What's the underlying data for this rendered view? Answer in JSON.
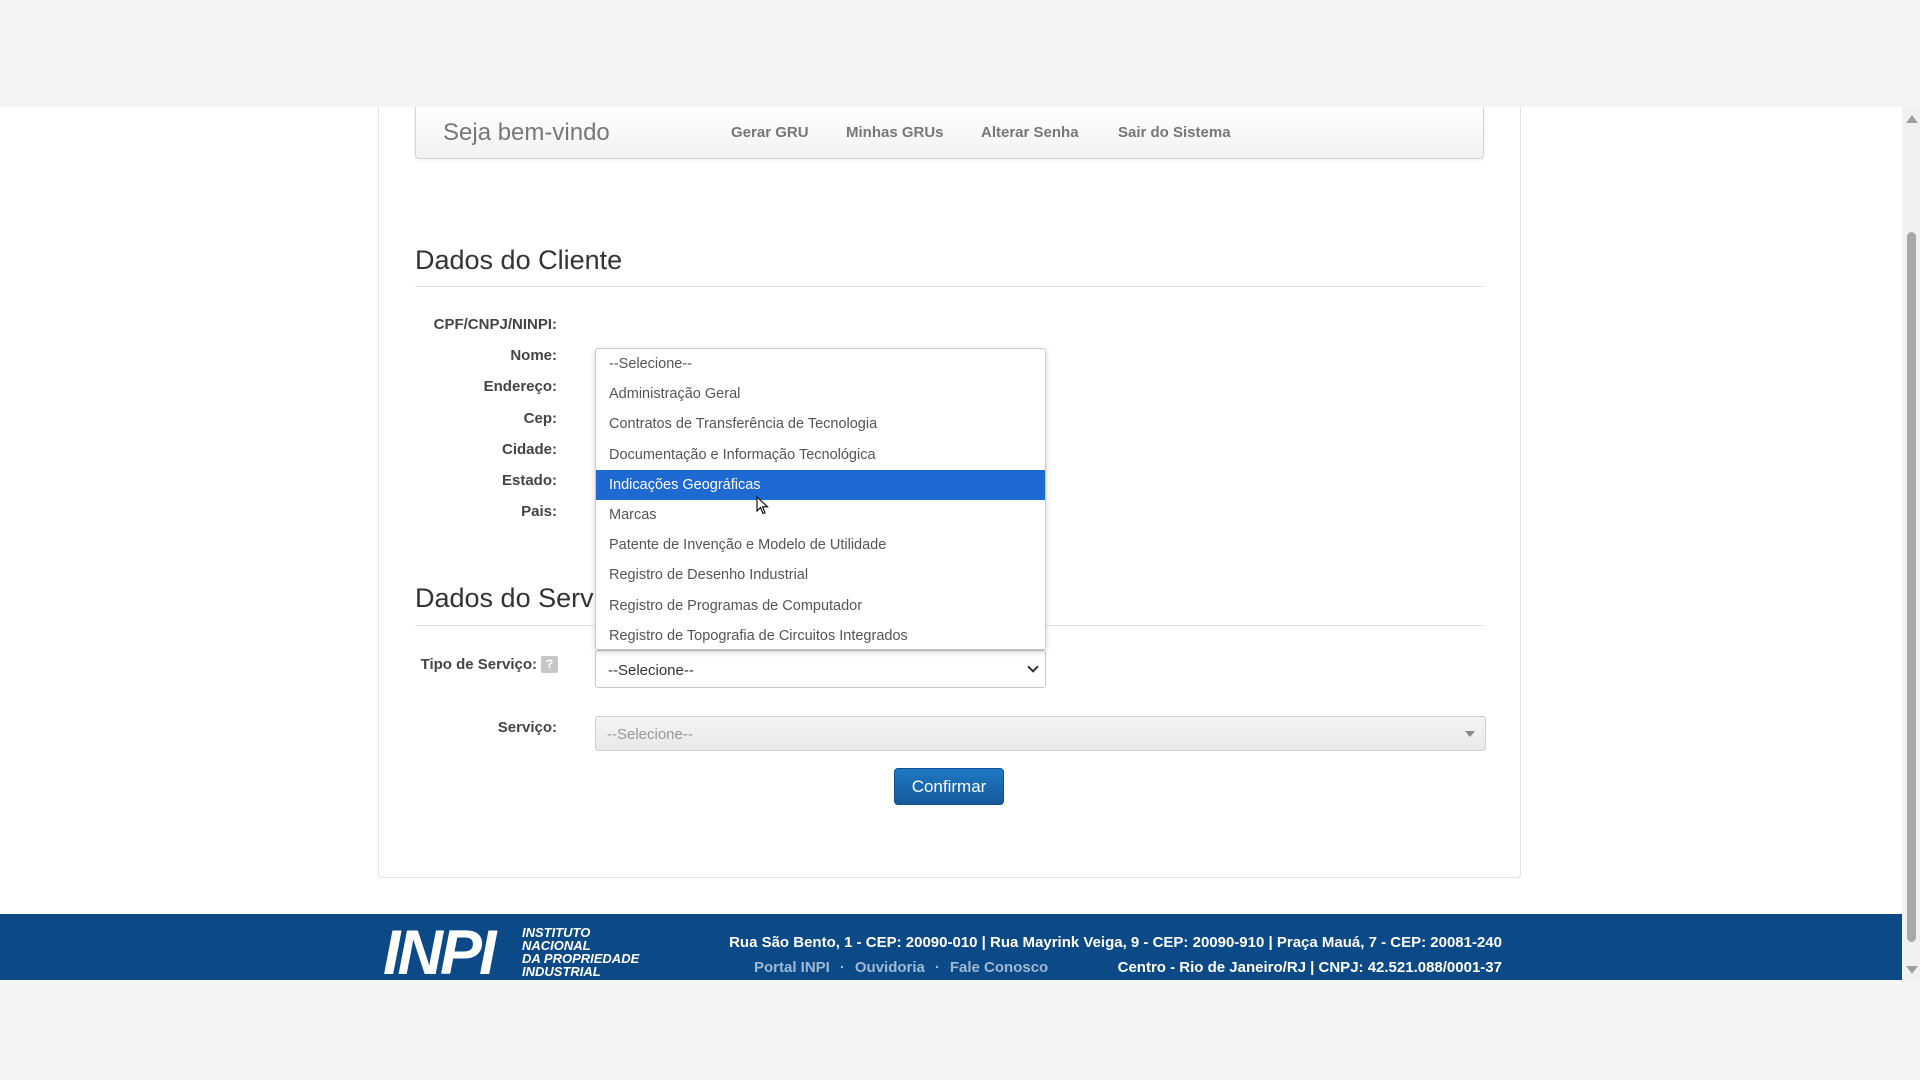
{
  "navbar": {
    "brand": "Seja bem-vindo",
    "links": [
      "Gerar GRU",
      "Minhas GRUs",
      "Alterar Senha",
      "Sair do Sistema"
    ]
  },
  "cliente": {
    "title": "Dados do Cliente",
    "labels": {
      "cpf": "CPF/CNPJ/NINPI:",
      "nome": "Nome:",
      "endereco": "Endereço:",
      "cep": "Cep:",
      "cidade": "Cidade:",
      "estado": "Estado:",
      "pais": "Pais:"
    }
  },
  "servico_section": {
    "title": "Dados do Servi",
    "tipo_label": "Tipo de Serviço:",
    "tipo_value": "--Selecione--",
    "help_icon_glyph": "?",
    "servico_label": "Serviço:",
    "servico_value": "--Selecione--",
    "confirm_label": "Confirmar"
  },
  "dropdown": {
    "options": [
      "--Selecione--",
      "Administração Geral",
      "Contratos de Transferência de Tecnologia",
      "Documentação e Informação Tecnológica",
      "Indicações Geográficas",
      "Marcas",
      "Patente de Invenção e Modelo de Utilidade",
      "Registro de Desenho Industrial",
      "Registro de Programas de Computador",
      "Registro de Topografia de Circuitos Integrados"
    ],
    "highlighted_index": 4,
    "highlight_color": "#1e69d2"
  },
  "footer": {
    "logo_mark": "INPI",
    "logo_lines": [
      "INSTITUTO",
      "NACIONAL",
      "DA PROPRIEDADE",
      "INDUSTRIAL"
    ],
    "address": "Rua São Bento, 1 - CEP: 20090-010 | Rua Mayrink Veiga, 9 - CEP: 20090-910 | Praça Mauá, 7 - CEP: 20081-240",
    "links": [
      "Portal INPI",
      "Ouvidoria",
      "Fale Conosco"
    ],
    "link_separator": "·",
    "cnpj": "Centro - Rio de Janeiro/RJ | CNPJ: 42.521.088/0001-37",
    "bg_color": "#0b4a86"
  }
}
